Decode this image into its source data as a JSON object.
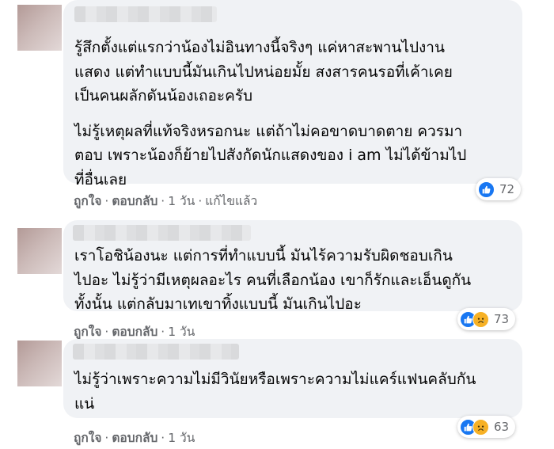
{
  "comments": [
    {
      "paragraphs": [
        "รู้สึกตั้งแต่แรกว่าน้องไม่อินทางนี้จริงๆ แค่หาสะพานไปงานแสดง แต่ทำแบบนี้มันเกินไปหน่อยมั้ย สงสารคนรอที่เค้าเคยเป็นคนผลักดันน้องเถอะครับ",
        "ไม่รู้เหตุผลที่แท้จริงหรอกนะ แต่ถ้าไม่คอขาดบาดตาย ควรมาตอบ เพราะน้องก็ย้ายไปสังกัดนักแสดงของ i am ไม่ได้ข้ามไปที่อื่นเลย"
      ],
      "lines": [
        [
          "รู้สึกตั้งแต่แรกว่าน้องไม่อินทางนี้จริงๆ แค่หาสะพานไปงาน",
          "แสดง แต่ทำแบบนี้มันเกินไปหน่อยมั้ย สงสารคนรอที่เค้าเคย",
          "เป็นคนผลักดันน้องเถอะครับ"
        ],
        [
          "ไม่รู้เหตุผลที่แท้จริงหรอกนะ แต่ถ้าไม่คอขาดบาดตาย ควรมา",
          "ตอบ เพราะน้องก็ย้ายไปสังกัดนักแสดงของ i am ไม่ได้ข้ามไป",
          "ที่อื่นเลย"
        ]
      ],
      "like_label": "ถูกใจ",
      "reply_label": "ตอบกลับ",
      "time": "1 วัน",
      "edited": "แก้ไขแล้ว",
      "reaction_count": "72",
      "reactions": [
        "like-icon"
      ]
    },
    {
      "lines": [
        [
          "เราโอชิน้องนะ แต่การที่ทำแบบนี้ มันไร้ความรับผิดชอบเกิน",
          "ไปอะ ไม่รู้ว่ามีเหตุผลอะไร คนที่เลือกน้อง เขาก็รักและเอ็นดูกัน",
          "ทั้งนั้น แต่กลับมาเทเขาทิ้งแบบนี้ มันเกินไปอะ"
        ]
      ],
      "like_label": "ถูกใจ",
      "reply_label": "ตอบกลับ",
      "time": "1 วัน",
      "reaction_count": "73",
      "reactions": [
        "like-icon",
        "sad-icon"
      ]
    },
    {
      "lines": [
        [
          "ไม่รู้ว่าเพราะความไม่มีวินัยหรือเพราะความไม่แคร์แฟนคลับกัน",
          "แน่"
        ]
      ],
      "like_label": "ถูกใจ",
      "reply_label": "ตอบกลับ",
      "time": "1 วัน",
      "reaction_count": "63",
      "reactions": [
        "like-icon",
        "sad-icon"
      ]
    }
  ],
  "colors": {
    "bubble": "#f0f2f5",
    "like": "#1877f2",
    "sad": "#f7b125",
    "meta": "#65676b"
  }
}
